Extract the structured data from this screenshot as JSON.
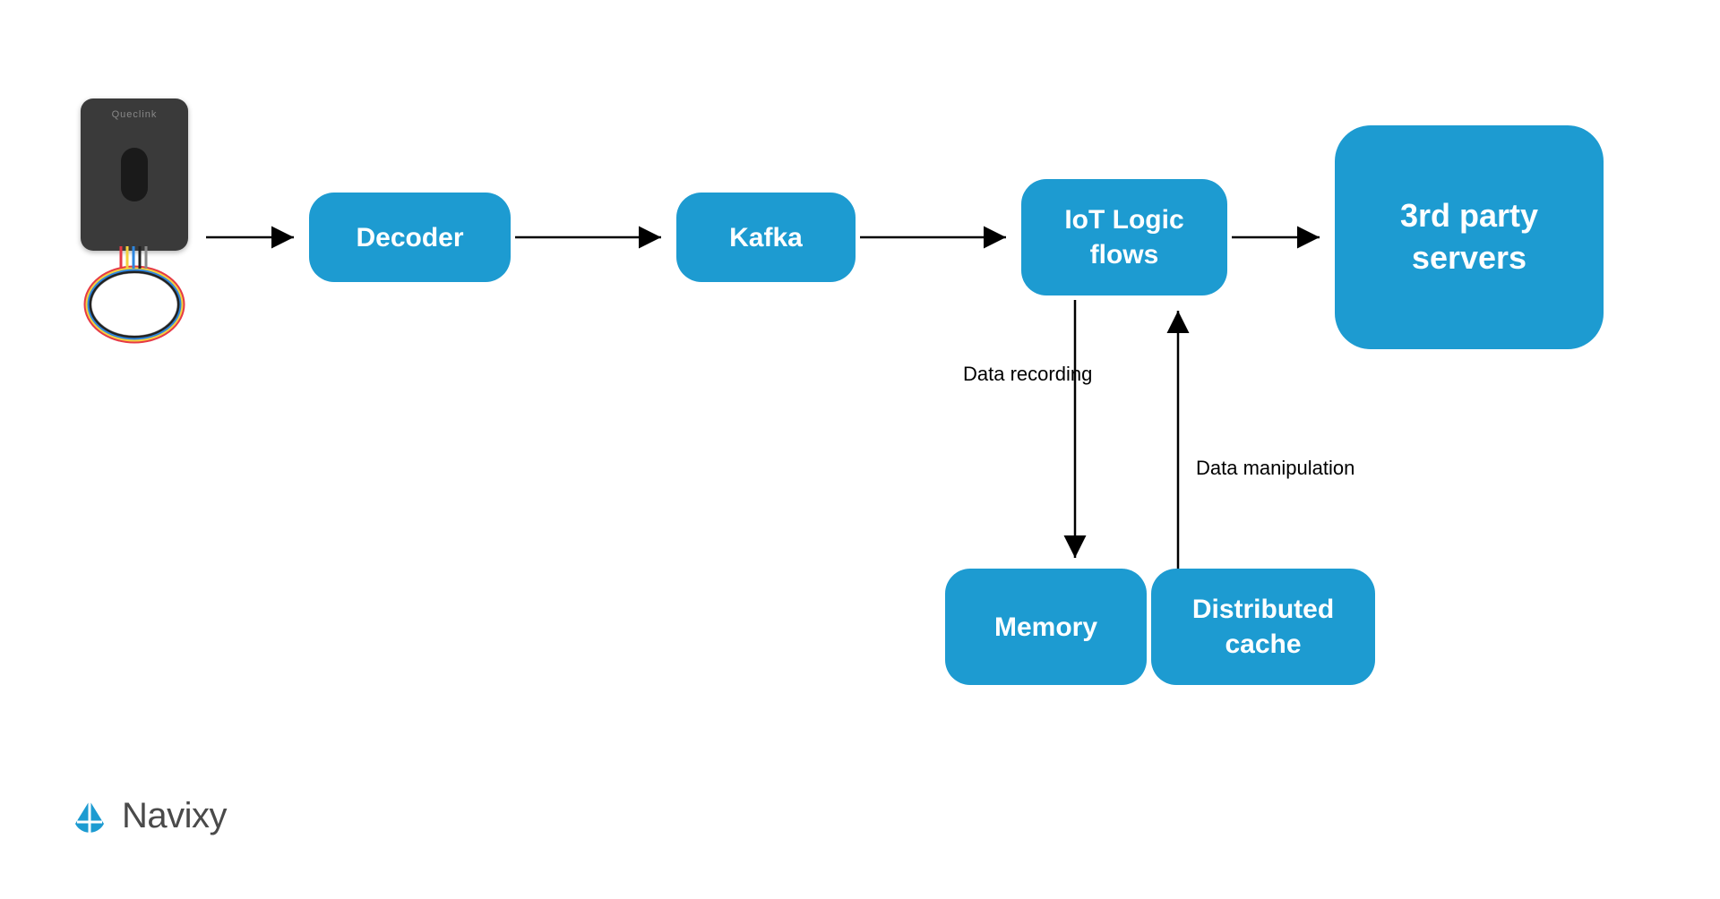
{
  "nodes": {
    "decoder": "Decoder",
    "kafka": "Kafka",
    "iot_logic": "IoT Logic flows",
    "third_party": "3rd party servers",
    "memory": "Memory",
    "distributed_cache": "Distributed cache"
  },
  "labels": {
    "data_recording": "Data recording",
    "data_manipulation": "Data manipulation"
  },
  "brand": {
    "name": "Navixy"
  },
  "colors": {
    "node_bg": "#1d9bd1",
    "node_text": "#ffffff",
    "arrow": "#000000",
    "logo_text": "#4a4a4a",
    "logo_icon": "#1d9bd1"
  }
}
